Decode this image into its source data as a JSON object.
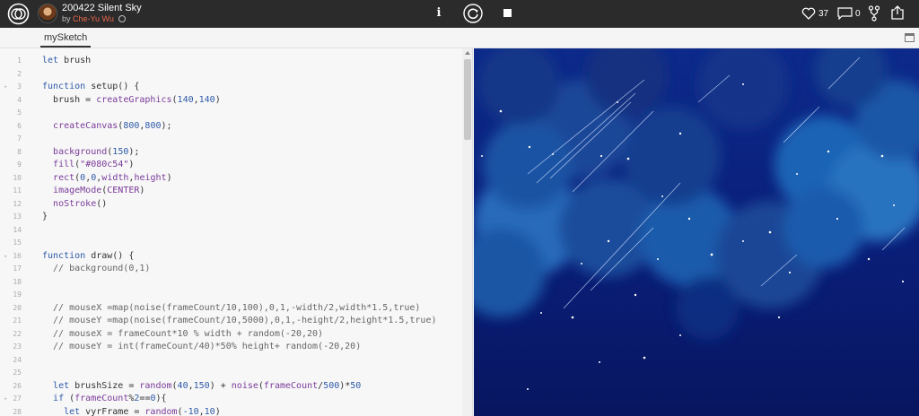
{
  "header": {
    "title": "200422 Silent Sky",
    "by_label": "by",
    "author": "Che-Yu Wu",
    "likes": "37",
    "comments": "0"
  },
  "tab": {
    "label": "mySketch"
  },
  "icons": {
    "logo": "openprocessing-logo-icon",
    "avatar": "author-avatar",
    "info": "info-icon",
    "restart": "restart-icon",
    "stop": "stop-icon",
    "heart": "heart-icon",
    "comment": "comment-icon",
    "fork": "fork-icon",
    "share": "share-icon",
    "expand": "expand-icon"
  },
  "colors": {
    "topbar": "#2b2b2b",
    "author": "#e8664a",
    "keyword": "#2e5aa8",
    "function": "#7a3a9a",
    "canvas_bg": "#0b1b66"
  },
  "code_lines": [
    {
      "n": "1",
      "fold": false,
      "tokens": [
        [
          "kw",
          "let"
        ],
        [
          "t",
          " brush"
        ]
      ]
    },
    {
      "n": "2",
      "fold": false,
      "tokens": []
    },
    {
      "n": "3",
      "fold": true,
      "tokens": [
        [
          "kw",
          "function"
        ],
        [
          "t",
          " setup() {"
        ]
      ]
    },
    {
      "n": "4",
      "fold": false,
      "tokens": [
        [
          "t",
          "  brush = "
        ],
        [
          "fn",
          "createGraphics"
        ],
        [
          "t",
          "("
        ],
        [
          "num",
          "140"
        ],
        [
          "t",
          ","
        ],
        [
          "num",
          "140"
        ],
        [
          "t",
          ")"
        ]
      ]
    },
    {
      "n": "5",
      "fold": false,
      "tokens": []
    },
    {
      "n": "6",
      "fold": false,
      "tokens": [
        [
          "t",
          "  "
        ],
        [
          "fn",
          "createCanvas"
        ],
        [
          "t",
          "("
        ],
        [
          "num",
          "800"
        ],
        [
          "t",
          ","
        ],
        [
          "num",
          "800"
        ],
        [
          "t",
          ");"
        ]
      ]
    },
    {
      "n": "7",
      "fold": false,
      "tokens": []
    },
    {
      "n": "8",
      "fold": false,
      "tokens": [
        [
          "t",
          "  "
        ],
        [
          "fn",
          "background"
        ],
        [
          "t",
          "("
        ],
        [
          "num",
          "150"
        ],
        [
          "t",
          ");"
        ]
      ]
    },
    {
      "n": "9",
      "fold": false,
      "tokens": [
        [
          "t",
          "  "
        ],
        [
          "fn",
          "fill"
        ],
        [
          "t",
          "("
        ],
        [
          "str",
          "\"#080c54\""
        ],
        [
          "t",
          ")"
        ]
      ]
    },
    {
      "n": "10",
      "fold": false,
      "tokens": [
        [
          "t",
          "  "
        ],
        [
          "fn",
          "rect"
        ],
        [
          "t",
          "("
        ],
        [
          "num",
          "0"
        ],
        [
          "t",
          ","
        ],
        [
          "num",
          "0"
        ],
        [
          "t",
          ","
        ],
        [
          "fn",
          "width"
        ],
        [
          "t",
          ","
        ],
        [
          "fn",
          "height"
        ],
        [
          "t",
          ")"
        ]
      ]
    },
    {
      "n": "11",
      "fold": false,
      "tokens": [
        [
          "t",
          "  "
        ],
        [
          "fn",
          "imageMode"
        ],
        [
          "t",
          "("
        ],
        [
          "fn",
          "CENTER"
        ],
        [
          "t",
          ")"
        ]
      ]
    },
    {
      "n": "12",
      "fold": false,
      "tokens": [
        [
          "t",
          "  "
        ],
        [
          "fn",
          "noStroke"
        ],
        [
          "t",
          "()"
        ]
      ]
    },
    {
      "n": "13",
      "fold": false,
      "tokens": [
        [
          "t",
          "}"
        ]
      ]
    },
    {
      "n": "14",
      "fold": false,
      "tokens": []
    },
    {
      "n": "15",
      "fold": false,
      "tokens": []
    },
    {
      "n": "16",
      "fold": true,
      "tokens": [
        [
          "kw",
          "function"
        ],
        [
          "t",
          " draw() {"
        ]
      ]
    },
    {
      "n": "17",
      "fold": false,
      "tokens": [
        [
          "cm",
          "  // background(0,1)"
        ]
      ]
    },
    {
      "n": "18",
      "fold": false,
      "tokens": []
    },
    {
      "n": "19",
      "fold": false,
      "tokens": []
    },
    {
      "n": "20",
      "fold": false,
      "tokens": [
        [
          "cm",
          "  // mouseX =map(noise(frameCount/10,100),0,1,-width/2,width*1.5,true)"
        ]
      ]
    },
    {
      "n": "21",
      "fold": false,
      "tokens": [
        [
          "cm",
          "  // mouseY =map(noise(frameCount/10,5000),0,1,-height/2,height*1.5,true)"
        ]
      ]
    },
    {
      "n": "22",
      "fold": false,
      "tokens": [
        [
          "cm",
          "  // mouseX = frameCount*10 % width + random(-20,20)"
        ]
      ]
    },
    {
      "n": "23",
      "fold": false,
      "tokens": [
        [
          "cm",
          "  // mouseY = int(frameCount/40)*50% height+ random(-20,20)"
        ]
      ]
    },
    {
      "n": "24",
      "fold": false,
      "tokens": []
    },
    {
      "n": "25",
      "fold": false,
      "tokens": []
    },
    {
      "n": "26",
      "fold": false,
      "tokens": [
        [
          "t",
          "  "
        ],
        [
          "kw",
          "let"
        ],
        [
          "t",
          " brushSize = "
        ],
        [
          "fn",
          "random"
        ],
        [
          "t",
          "("
        ],
        [
          "num",
          "40"
        ],
        [
          "t",
          ","
        ],
        [
          "num",
          "150"
        ],
        [
          "t",
          ") + "
        ],
        [
          "fn",
          "noise"
        ],
        [
          "t",
          "("
        ],
        [
          "fn",
          "frameCount"
        ],
        [
          "t",
          "/"
        ],
        [
          "num",
          "500"
        ],
        [
          "t",
          ")*"
        ],
        [
          "num",
          "50"
        ]
      ]
    },
    {
      "n": "27",
      "fold": true,
      "tokens": [
        [
          "t",
          "  "
        ],
        [
          "kw",
          "if"
        ],
        [
          "t",
          " ("
        ],
        [
          "fn",
          "frameCount"
        ],
        [
          "t",
          "%"
        ],
        [
          "num",
          "2"
        ],
        [
          "t",
          "=="
        ],
        [
          "num",
          "0"
        ],
        [
          "t",
          "){"
        ]
      ]
    },
    {
      "n": "28",
      "fold": false,
      "tokens": [
        [
          "t",
          "    "
        ],
        [
          "kw",
          "let"
        ],
        [
          "t",
          " vyrFrame = "
        ],
        [
          "fn",
          "random"
        ],
        [
          "t",
          "("
        ],
        [
          "num",
          "-10"
        ],
        [
          "t",
          ","
        ],
        [
          "num",
          "10"
        ],
        [
          "t",
          ")"
        ]
      ]
    }
  ]
}
